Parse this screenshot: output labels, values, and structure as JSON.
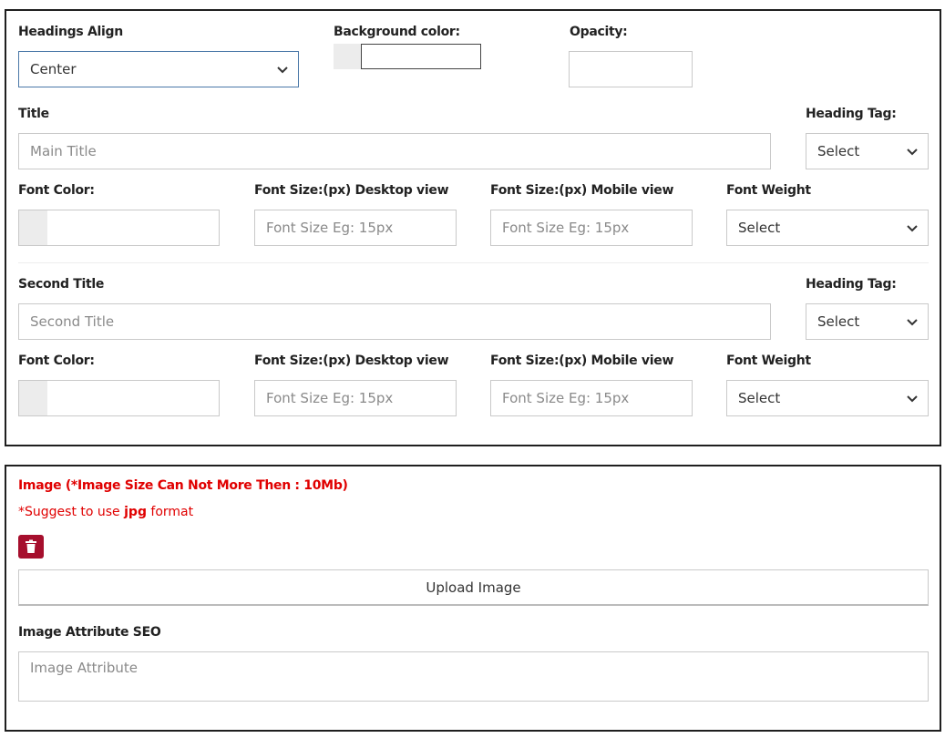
{
  "headings_align": {
    "label": "Headings Align",
    "value": "Center"
  },
  "background_color": {
    "label": "Background color:",
    "value": ""
  },
  "opacity": {
    "label": "Opacity:",
    "value": ""
  },
  "title_section": {
    "title_label": "Title",
    "title_placeholder": "Main Title",
    "heading_tag_label": "Heading Tag:",
    "heading_tag_value": "Select",
    "font_color_label": "Font Color:",
    "font_size_desktop_label": "Font Size:(px) Desktop view",
    "font_size_desktop_placeholder": "Font Size Eg: 15px",
    "font_size_mobile_label": "Font Size:(px) Mobile view",
    "font_size_mobile_placeholder": "Font Size Eg: 15px",
    "font_weight_label": "Font Weight",
    "font_weight_value": "Select"
  },
  "second_title_section": {
    "title_label": "Second Title",
    "title_placeholder": "Second Title",
    "heading_tag_label": "Heading Tag:",
    "heading_tag_value": "Select",
    "font_color_label": "Font Color:",
    "font_size_desktop_label": "Font Size:(px) Desktop view",
    "font_size_desktop_placeholder": "Font Size Eg: 15px",
    "font_size_mobile_label": "Font Size:(px) Mobile view",
    "font_size_mobile_placeholder": "Font Size Eg: 15px",
    "font_weight_label": "Font Weight",
    "font_weight_value": "Select"
  },
  "image_section": {
    "image_label": "Image (*Image Size Can Not More Then :  10Mb)",
    "suggest_prefix": "*Suggest to use ",
    "suggest_format": "jpg",
    "suggest_suffix": " format",
    "delete_icon": "trash-icon",
    "upload_button": "Upload Image",
    "seo_label": "Image Attribute SEO",
    "seo_placeholder": "Image Attribute"
  },
  "colors": {
    "accent_red": "#e00000",
    "delete_button": "#a60f2d",
    "active_border": "#4a78a8",
    "swatch": "#ececec"
  }
}
